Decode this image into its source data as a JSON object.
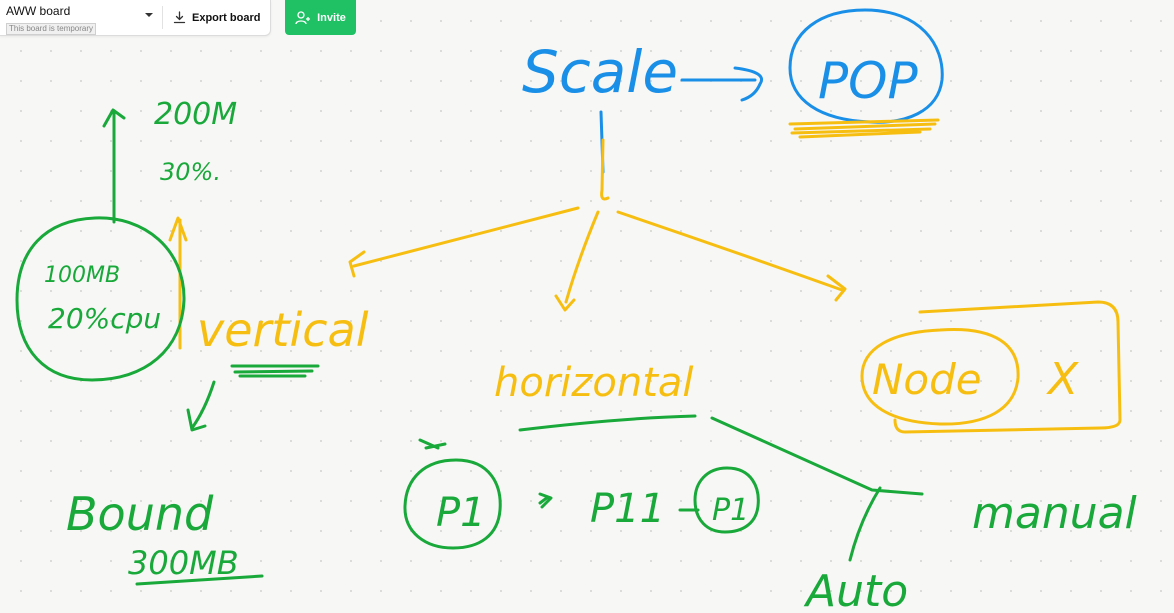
{
  "toolbar": {
    "board_title": "AWW board",
    "board_status": "This board is temporary",
    "export_label": "Export board",
    "invite_label": "Invite"
  },
  "icons": {
    "dropdown": "chevron-down-icon",
    "export": "download-icon",
    "invite": "add-user-icon"
  },
  "colors": {
    "blue": "#1a8fe8",
    "yellow": "#f7be12",
    "green": "#19a83a",
    "invite_button": "#20c064"
  },
  "sketch": {
    "scale": "Scale",
    "pop": "POP",
    "zoom": "200M",
    "percent": "30%.",
    "vm_mem": "100MB",
    "vm_cpu": "20%cpu",
    "vertical": "vertical",
    "bound": "Bound",
    "bound_value": "300MB",
    "horizontal": "horizontal",
    "p1": "P1",
    "p11": "P11",
    "p1_b": "P1",
    "node": "Node",
    "cross": "X",
    "manual": "manual",
    "auto": "Auto"
  }
}
